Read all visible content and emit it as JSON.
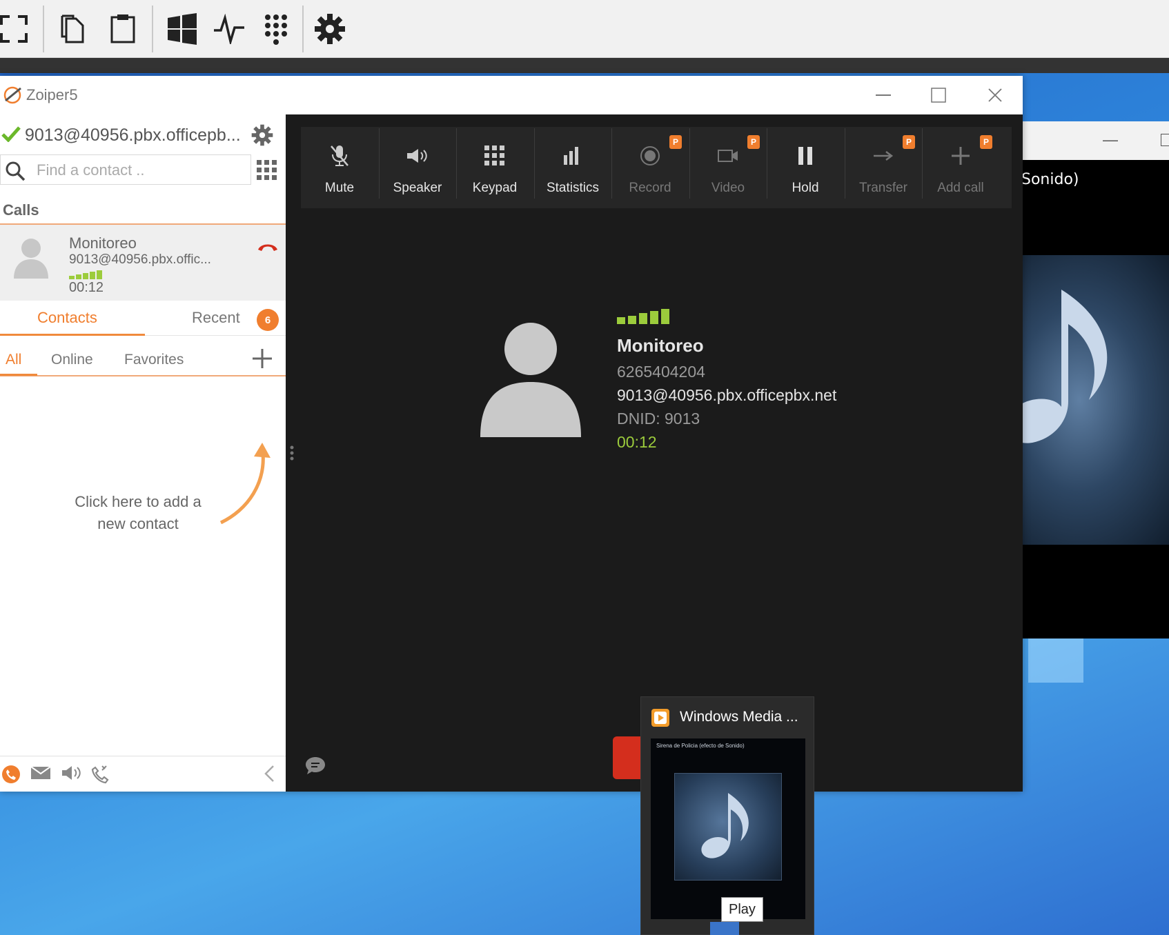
{
  "topbar": {
    "icons": [
      "fullscreen-icon",
      "copy-icon",
      "clipboard-icon",
      "windows-icon",
      "activity-icon",
      "keypad-icon",
      "gear-icon"
    ]
  },
  "background_window": {
    "song_title_partial": "Sonido)"
  },
  "zoiper": {
    "title": "Zoiper5",
    "account": "9013@40956.pbx.officepb...",
    "search_placeholder": "Find a contact ..",
    "calls_header": "Calls",
    "active_call": {
      "name": "Monitoreo",
      "uri": "9013@40956.pbx.offic...",
      "time": "00:12"
    },
    "tabs": {
      "contacts": "Contacts",
      "recent": "Recent",
      "recent_badge": "6"
    },
    "filters": {
      "all": "All",
      "online": "Online",
      "favorites": "Favorites"
    },
    "add_contact_hint": "Click here to add a new contact",
    "toolbar": [
      {
        "label": "Mute",
        "icon": "mic-off-icon",
        "enabled": true,
        "premium": false
      },
      {
        "label": "Speaker",
        "icon": "speaker-icon",
        "enabled": true,
        "premium": false
      },
      {
        "label": "Keypad",
        "icon": "keypad-icon",
        "enabled": true,
        "premium": false
      },
      {
        "label": "Statistics",
        "icon": "statistics-icon",
        "enabled": true,
        "premium": false
      },
      {
        "label": "Record",
        "icon": "record-icon",
        "enabled": false,
        "premium": true
      },
      {
        "label": "Video",
        "icon": "video-icon",
        "enabled": false,
        "premium": true
      },
      {
        "label": "Hold",
        "icon": "pause-icon",
        "enabled": true,
        "premium": false
      },
      {
        "label": "Transfer",
        "icon": "transfer-icon",
        "enabled": false,
        "premium": true
      },
      {
        "label": "Add call",
        "icon": "add-call-icon",
        "enabled": false,
        "premium": true
      }
    ],
    "premium_badge": "P",
    "caller": {
      "name": "Monitoreo",
      "number": "6265404204",
      "uri": "9013@40956.pbx.officepbx.net",
      "dnid": "DNID: 9013",
      "duration": "00:12"
    }
  },
  "wmp_preview": {
    "title": "Windows Media ...",
    "song": "Sirena de Policia (efecto de Sonido)",
    "tooltip": "Play"
  },
  "colors": {
    "accent_orange": "#f07e2e",
    "signal_green": "#9ccc3c",
    "hangup_red": "#d42e1d",
    "call_panel_bg": "#1b1b1b"
  }
}
